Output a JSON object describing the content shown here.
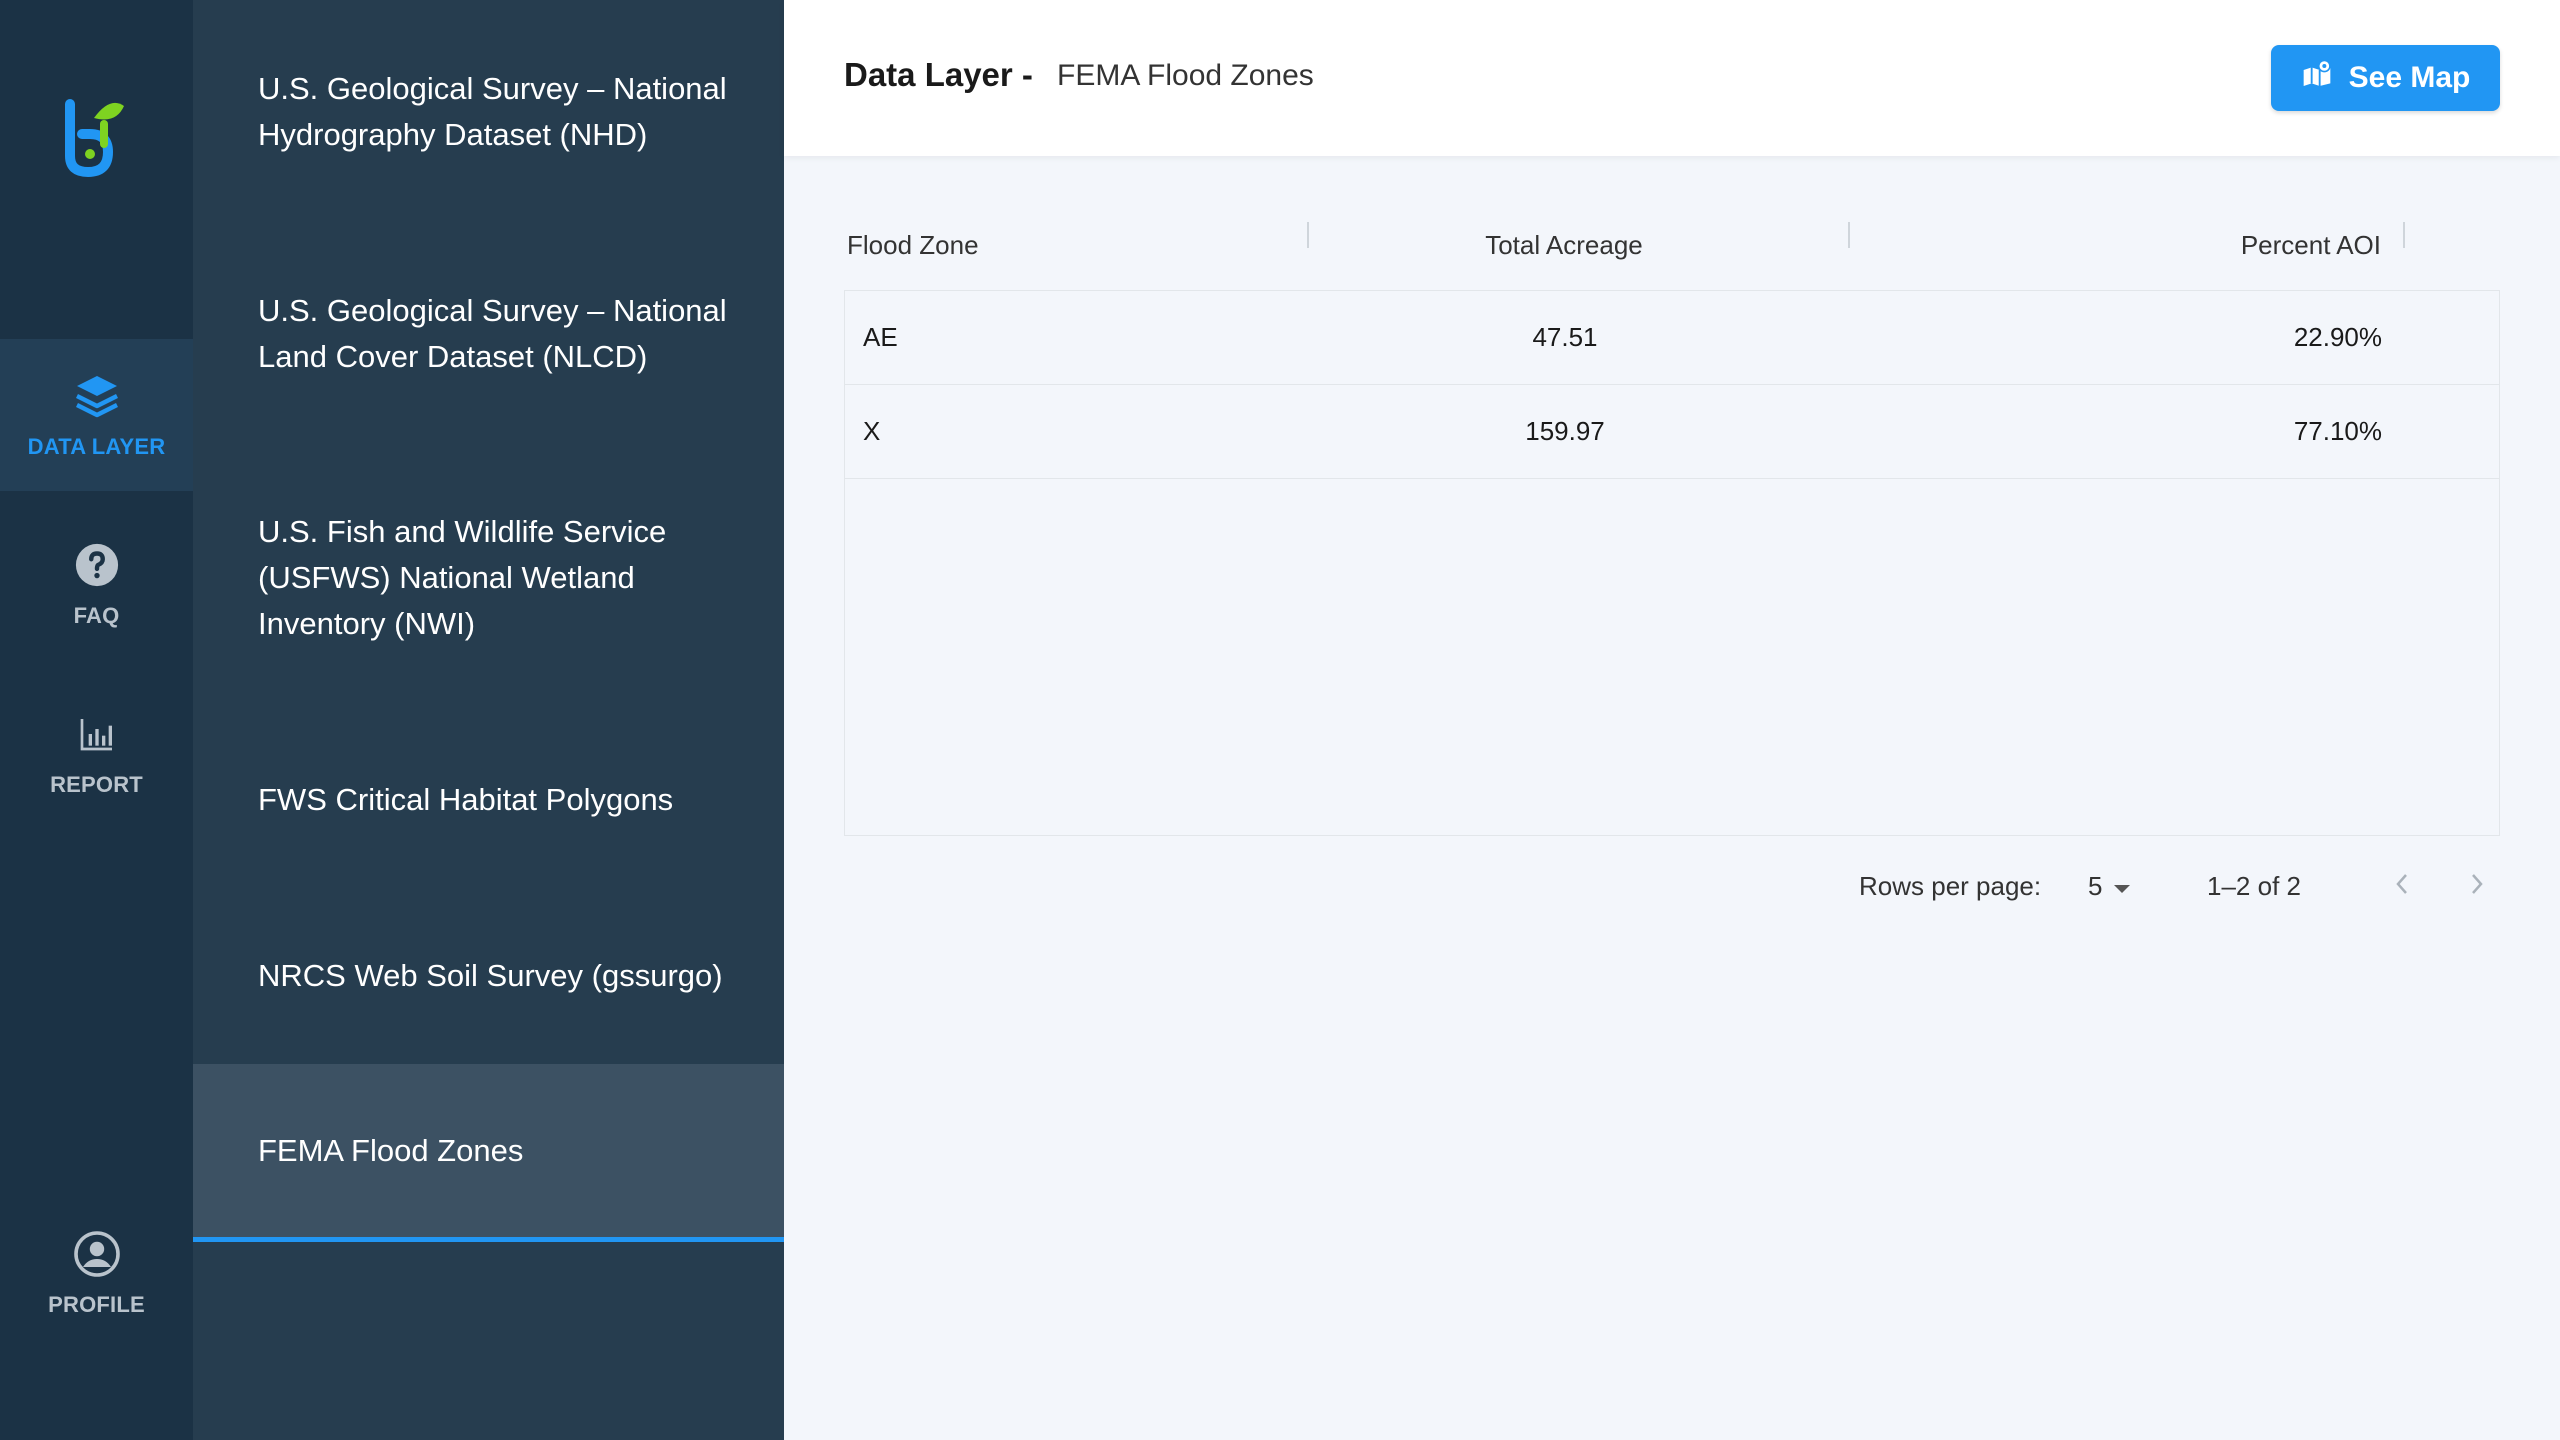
{
  "rail": {
    "items": [
      {
        "label": "DATA LAYER",
        "icon": "layers-icon"
      },
      {
        "label": "FAQ",
        "icon": "help-circle-icon"
      },
      {
        "label": "REPORT",
        "icon": "bar-chart-icon"
      },
      {
        "label": "PROFILE",
        "icon": "account-circle-icon"
      }
    ]
  },
  "datasets": [
    "U.S. Geological Survey – National Hydrography Dataset (NHD)",
    "U.S. Geological Survey – National Land Cover Dataset (NLCD)",
    "U.S. Fish and Wildlife Service (USFWS) National Wetland Inventory (NWI)",
    "FWS Critical Habitat Polygons",
    "NRCS Web Soil Survey (gssurgo)",
    "FEMA Flood Zones"
  ],
  "header": {
    "title_label": "Data Layer -",
    "title_value": "FEMA Flood Zones",
    "see_map_label": "See Map"
  },
  "table": {
    "columns": [
      "Flood Zone",
      "Total Acreage",
      "Percent AOI"
    ],
    "rows": [
      [
        "AE",
        "47.51",
        "22.90%"
      ],
      [
        "X",
        "159.97",
        "77.10%"
      ]
    ]
  },
  "pagination": {
    "rows_per_page_label": "Rows per page:",
    "rows_per_page_value": "5",
    "range_text": "1–2 of 2"
  },
  "colors": {
    "accent": "#2196f3",
    "rail_bg": "#1b3245",
    "panel_bg": "#263d4f",
    "panel_active_bg": "#3c5163",
    "logo_blue": "#2196f3",
    "logo_green": "#7ed321"
  }
}
